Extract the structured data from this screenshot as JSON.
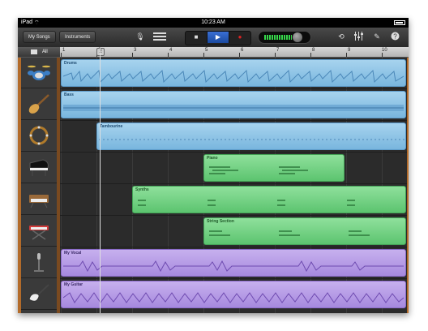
{
  "status_bar": {
    "carrier": "iPad",
    "wifi_icon": "wifi-icon",
    "time": "10:23 AM",
    "battery_icon": "battery-icon"
  },
  "toolbar": {
    "my_songs": "My Songs",
    "instruments": "Instruments",
    "icons": [
      "microphone-icon",
      "tracks-view-icon",
      "stop-icon",
      "play-icon",
      "record-icon",
      "loop-icon",
      "mixer-icon",
      "settings-wrench-icon",
      "help-icon"
    ]
  },
  "ruler": {
    "all_label": "All",
    "bars": [
      "1",
      "2",
      "3",
      "4",
      "5",
      "6",
      "7",
      "8",
      "9",
      "10"
    ],
    "playhead_bar": "2"
  },
  "tracks": [
    {
      "name": "Drums",
      "instrument": "drum-kit-icon"
    },
    {
      "name": "Bass",
      "instrument": "bass-guitar-icon"
    },
    {
      "name": "Tambourine",
      "instrument": "tambourine-icon"
    },
    {
      "name": "Piano",
      "instrument": "grand-piano-icon"
    },
    {
      "name": "Synths",
      "instrument": "keyboard-synth-icon"
    },
    {
      "name": "String Section",
      "instrument": "keyboard-stand-icon"
    },
    {
      "name": "My Vocal",
      "instrument": "microphone-stand-icon"
    },
    {
      "name": "My Guitar",
      "instrument": "electric-guitar-icon"
    }
  ],
  "colors": {
    "audio_blue": "#8cc4e8",
    "midi_green": "#6fd07f",
    "vocal_purple": "#b59ae6",
    "wood": "#b36b2a"
  }
}
